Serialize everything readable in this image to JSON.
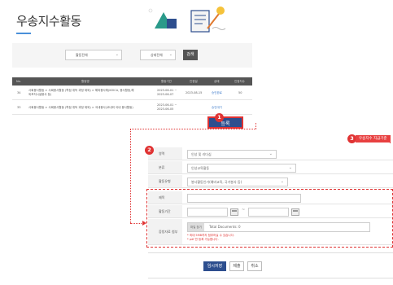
{
  "page": {
    "title": "우송지수활동"
  },
  "filter": {
    "category_select": "활동전체",
    "status_select": "상태전체",
    "search_button": "검색"
  },
  "table": {
    "columns": [
      "No.",
      "활동명",
      "활동기간",
      "인정일",
      "상태",
      "인정지수"
    ],
    "rows": [
      {
        "no": "34",
        "name_line1": "사회봉사활동 > 사회봉사활동 (학점 취득 과정 제외) > 해외봉사체(KOICA, 봉사활동,해",
        "name_line2": "외포지시설봉사 등)",
        "period_line1": "2023-06-01 ~",
        "period_line2": "2023-06-07",
        "approved": "2023-08-15",
        "status": "승인완료",
        "score": "50"
      },
      {
        "no": "33",
        "name_line1": "사회봉사활동 > 사회봉사활동 (학점 취득 과정 제외) > 국내봉사(교내외 국내 봉사활동)",
        "name_line2": "",
        "period_line1": "2023-06-01 ~",
        "period_line2": "2023-06-05",
        "approved": "",
        "status": "승인대기",
        "score": ""
      }
    ]
  },
  "register_button": "등록",
  "badges": {
    "b1": "1",
    "b2": "2",
    "b3": "3"
  },
  "tag3": "우송지수 지급기준",
  "form": {
    "row1_label": "영역",
    "row1_value": "인성 및 리더십",
    "row2_label": "분류",
    "row2_value": "인성교육활동",
    "row3_label": "활동유형",
    "row3_value": "봉사활동인가(예비교육, 국가봉사 등)",
    "row4_label": "제목",
    "row4_value": "",
    "row5_label": "활동기간",
    "row5_dash": "~",
    "row6_label": "증빙자료 첨부",
    "file_button": "파일 찾기",
    "file_text": "Total Documents: 0",
    "note1": "* 최대 5MB까지 첨부하실 수 있습니다.",
    "note2": "* pdf 만 등록 가능합니다."
  },
  "buttons": {
    "temp_save": "임시저장",
    "register": "제출",
    "cancel": "취소"
  }
}
